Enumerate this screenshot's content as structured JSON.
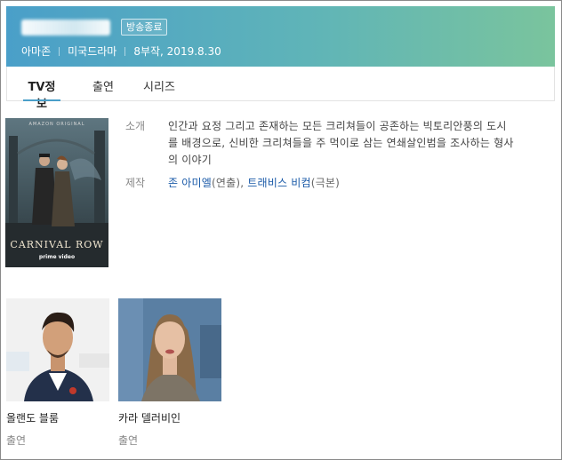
{
  "header": {
    "badge": "방송종료",
    "meta": [
      "아마존",
      "미국드라마",
      "8부작, 2019.8.30"
    ],
    "colors": {
      "gradient_start": "#4a9fc9",
      "gradient_end": "#7ac49d"
    }
  },
  "tabs": [
    {
      "label": "TV정보",
      "active": true
    },
    {
      "label": "출연",
      "active": false
    },
    {
      "label": "시리즈",
      "active": false
    }
  ],
  "poster": {
    "brand": "AMAZON ORIGINAL",
    "title": "CARNIVAL ROW",
    "network": "prime video"
  },
  "info": {
    "intro_label": "소개",
    "intro_lines": [
      "인간과 요정 그리고 존재하는 모든 크리쳐들이 공존하는 빅토리안풍의 도시",
      "를 배경으로, 신비한 크리쳐들을 주 먹이로 삼는 연쇄살인범을 조사하는 형사",
      "의 이야기"
    ],
    "production_label": "제작",
    "production": {
      "person1": "존 아미엘",
      "role1": "(연출)",
      "sep": ", ",
      "person2": "트래비스 비컴",
      "role2": "(극본)"
    }
  },
  "cast": [
    {
      "name": "올랜도 블룸",
      "role": "출연"
    },
    {
      "name": "카라 델러비인",
      "role": "출연"
    }
  ]
}
